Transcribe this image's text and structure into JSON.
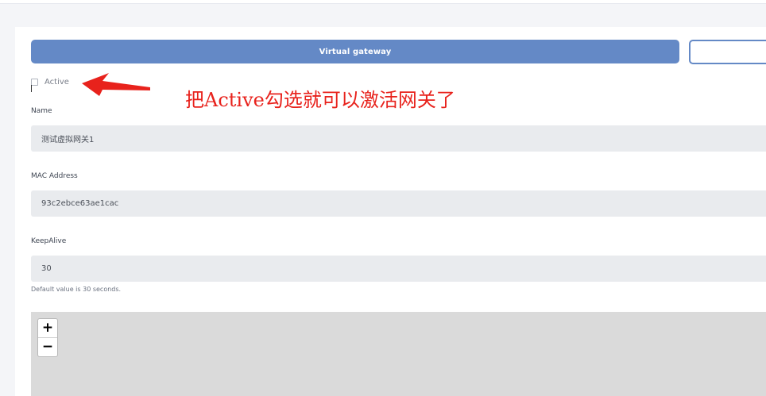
{
  "toolbar": {
    "primary_button_label": "Virtual gateway",
    "secondary_button_label": ""
  },
  "form": {
    "active": {
      "label": "Active",
      "checked": false
    },
    "name": {
      "label": "Name",
      "value": "测试虚拟网关1"
    },
    "mac": {
      "label": "MAC Address",
      "value": "93c2ebce63ae1cac"
    },
    "keepalive": {
      "label": "KeepAlive",
      "value": "30",
      "help": "Default value is 30 seconds."
    }
  },
  "map": {
    "zoom_in": "+",
    "zoom_out": "−"
  },
  "annotation": {
    "text": "把Active勾选就可以激活网关了",
    "color": "#e8221c"
  },
  "colors": {
    "accent": "#6489c6",
    "field_bg": "#e9ebee",
    "map_bg": "#dadada"
  }
}
